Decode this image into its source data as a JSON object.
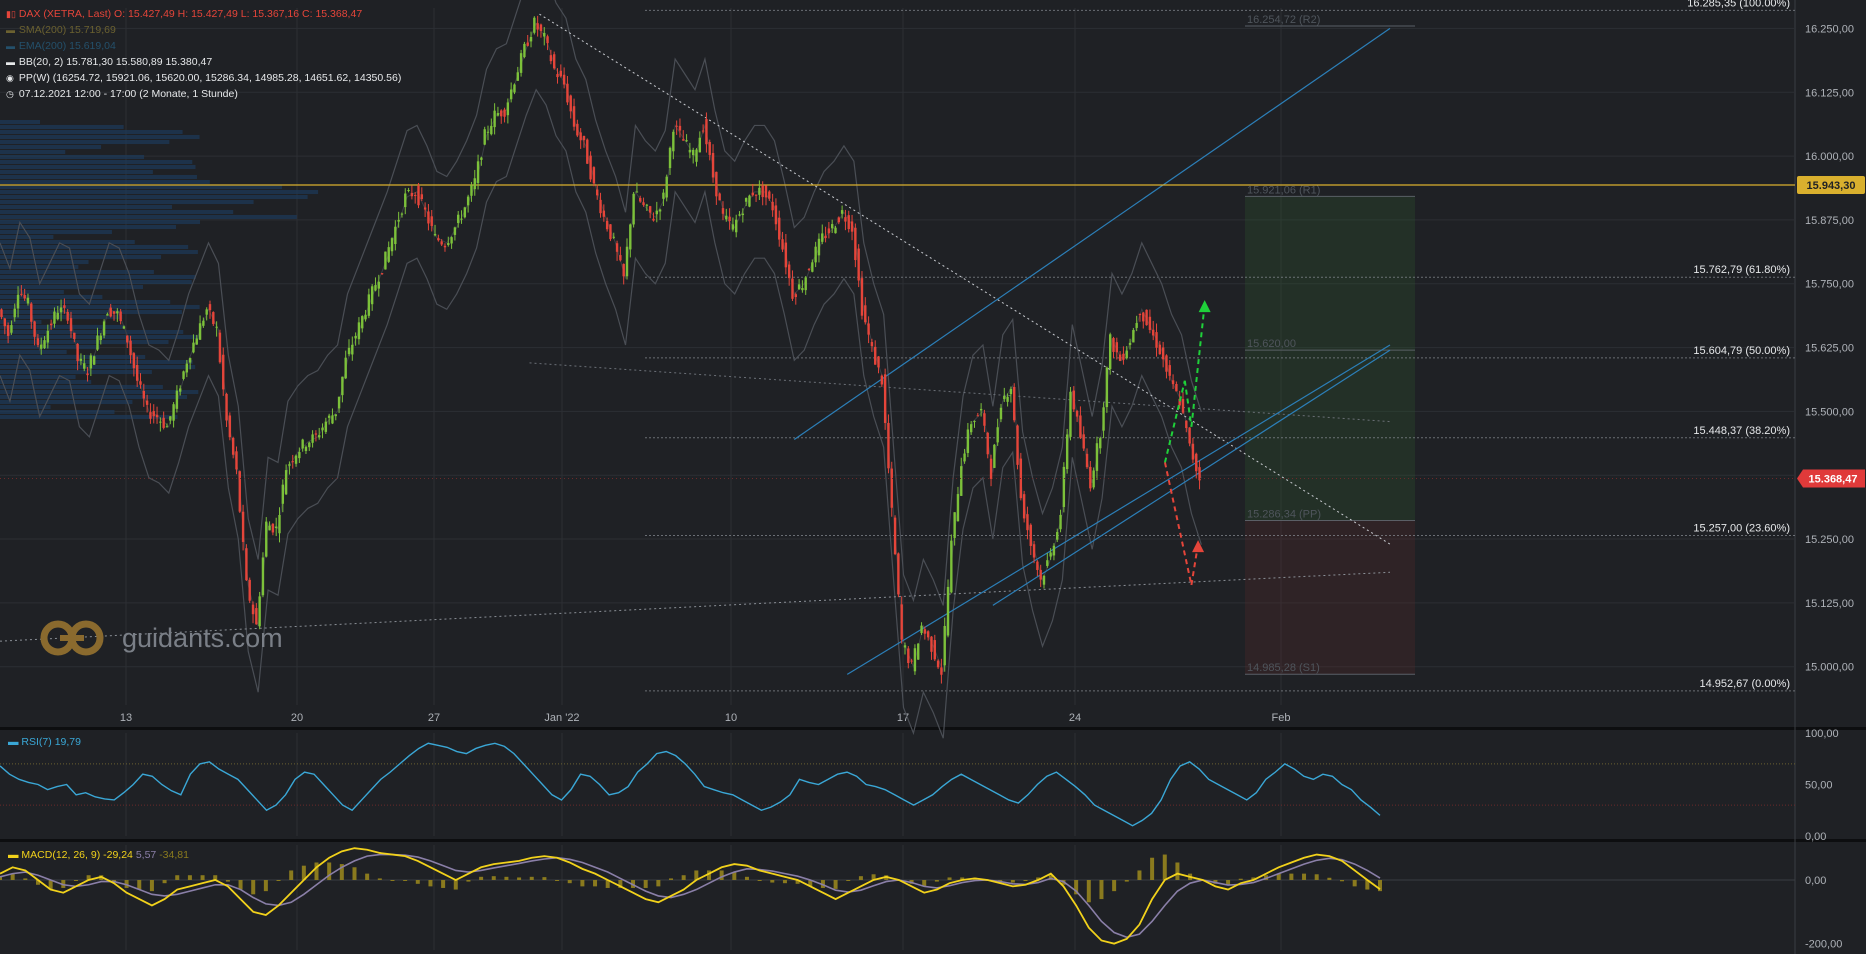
{
  "legend": {
    "instrument": "DAX (XETRA, Last)",
    "ohlc": "O: 15.427,49  H: 15.427,49  L: 15.367,16  C: 15.368,47",
    "sma_label": "SMA(200)",
    "sma_value": "15.719,69",
    "ema_label": "EMA(200)",
    "ema_value": "15.619,04",
    "bb_label": "BB(20, 2)",
    "bb_value": "15.781,30  15.580,89  15.380,47",
    "pp_label": "PP(W)",
    "pp_value": "(16254.72, 15921.06, 15620.00, 15286.34, 14985.28, 14651.62, 14350.56)",
    "period_label": "07.12.2021 12:00 - 17:00",
    "period_value": "(2 Monate, 1 Stunde)"
  },
  "watermark": "guidants.com",
  "colors": {
    "background": "#1f2125",
    "up": "#7cc13a",
    "down": "#e5453a",
    "grid": "#2c2f34",
    "horizontal_line": "#d9b02e",
    "channel": "#2c7fb8",
    "rsi": "#3aa7d6",
    "macd": "#f2d21b",
    "signal": "#8a7fa8",
    "histogram": "#8a7a1e",
    "price_badge": "#e03a3a"
  },
  "chart_data": [
    {
      "type": "candlestick",
      "title": "DAX (XETRA, Last)",
      "x_ticks": [
        "13",
        "20",
        "27",
        "Jan '22",
        "10",
        "17",
        "24",
        "Feb"
      ],
      "y_ticks": [
        "16.250,00",
        "16.125,00",
        "16.000,00",
        "15.875,00",
        "15.750,00",
        "15.625,00",
        "15.500,00",
        "15.375,00",
        "15.250,00",
        "15.125,00",
        "15.000,00"
      ],
      "ylim": [
        14925,
        16290
      ],
      "y_tick_values": [
        16250,
        16125,
        16000,
        15875,
        15750,
        15625,
        15500,
        15375,
        15250,
        15125,
        15000
      ],
      "pivot_labels": [
        "16.254,72 (R2)",
        "15.921,06 (R1)",
        "15.620,00",
        "15.286,34 (PP)",
        "14.985,28 (S1)"
      ],
      "pivot_values": [
        16254.72,
        15921.06,
        15620.0,
        15286.34,
        14985.28
      ],
      "fib_labels": [
        "16.285,35 (100.00%)",
        "15.762,79 (61.80%)",
        "15.604,79 (50.00%)",
        "15.448,37 (38.20%)",
        "15.257,00 (23.60%)",
        "14.952,67 (0.00%)"
      ],
      "fib_values": [
        16285.35,
        15762.79,
        15604.79,
        15448.37,
        15257.0,
        14952.67
      ],
      "horizontal_line": {
        "label": "15.943,30",
        "value": 15943.3
      },
      "last_price": {
        "label": "15.368,47",
        "value": 15368.47
      },
      "close_path": [
        [
          0,
          15700
        ],
        [
          3,
          15650
        ],
        [
          6,
          15740
        ],
        [
          9,
          15710
        ],
        [
          12,
          15620
        ],
        [
          15,
          15660
        ],
        [
          18,
          15700
        ],
        [
          21,
          15690
        ],
        [
          24,
          15600
        ],
        [
          27,
          15580
        ],
        [
          30,
          15640
        ],
        [
          33,
          15700
        ],
        [
          36,
          15690
        ],
        [
          39,
          15640
        ],
        [
          42,
          15560
        ],
        [
          45,
          15500
        ],
        [
          48,
          15490
        ],
        [
          51,
          15470
        ],
        [
          54,
          15530
        ],
        [
          57,
          15600
        ],
        [
          60,
          15650
        ],
        [
          63,
          15700
        ],
        [
          66,
          15660
        ],
        [
          69,
          15480
        ],
        [
          72,
          15380
        ],
        [
          75,
          15160
        ],
        [
          78,
          15080
        ],
        [
          81,
          15280
        ],
        [
          84,
          15270
        ],
        [
          87,
          15390
        ],
        [
          90,
          15420
        ],
        [
          93,
          15440
        ],
        [
          96,
          15450
        ],
        [
          99,
          15480
        ],
        [
          102,
          15500
        ],
        [
          105,
          15600
        ],
        [
          108,
          15650
        ],
        [
          111,
          15700
        ],
        [
          114,
          15750
        ],
        [
          117,
          15800
        ],
        [
          120,
          15860
        ],
        [
          123,
          15920
        ],
        [
          126,
          15930
        ],
        [
          129,
          15890
        ],
        [
          132,
          15840
        ],
        [
          135,
          15830
        ],
        [
          138,
          15860
        ],
        [
          141,
          15900
        ],
        [
          144,
          15950
        ],
        [
          147,
          16040
        ],
        [
          150,
          16080
        ],
        [
          153,
          16090
        ],
        [
          156,
          16150
        ],
        [
          159,
          16210
        ],
        [
          162,
          16260
        ],
        [
          165,
          16230
        ],
        [
          168,
          16170
        ],
        [
          171,
          16140
        ],
        [
          174,
          16060
        ],
        [
          177,
          16020
        ],
        [
          180,
          15940
        ],
        [
          183,
          15880
        ],
        [
          186,
          15830
        ],
        [
          189,
          15760
        ],
        [
          192,
          15930
        ],
        [
          195,
          15900
        ],
        [
          198,
          15880
        ],
        [
          201,
          15920
        ],
        [
          204,
          16060
        ],
        [
          207,
          16030
        ],
        [
          210,
          16000
        ],
        [
          213,
          16060
        ],
        [
          216,
          15960
        ],
        [
          219,
          15880
        ],
        [
          222,
          15860
        ],
        [
          225,
          15900
        ],
        [
          228,
          15930
        ],
        [
          231,
          15930
        ],
        [
          234,
          15900
        ],
        [
          237,
          15820
        ],
        [
          240,
          15730
        ],
        [
          243,
          15750
        ],
        [
          246,
          15800
        ],
        [
          249,
          15840
        ],
        [
          252,
          15860
        ],
        [
          255,
          15890
        ],
        [
          258,
          15860
        ],
        [
          261,
          15700
        ],
        [
          264,
          15620
        ],
        [
          267,
          15560
        ],
        [
          270,
          15300
        ],
        [
          273,
          15050
        ],
        [
          276,
          15000
        ],
        [
          279,
          15080
        ],
        [
          282,
          15040
        ],
        [
          285,
          14990
        ],
        [
          288,
          15240
        ],
        [
          291,
          15400
        ],
        [
          294,
          15480
        ],
        [
          297,
          15500
        ],
        [
          300,
          15380
        ],
        [
          303,
          15520
        ],
        [
          306,
          15550
        ],
        [
          309,
          15330
        ],
        [
          312,
          15240
        ],
        [
          315,
          15170
        ],
        [
          318,
          15220
        ],
        [
          321,
          15300
        ],
        [
          324,
          15540
        ],
        [
          327,
          15450
        ],
        [
          330,
          15360
        ],
        [
          333,
          15460
        ],
        [
          336,
          15640
        ],
        [
          339,
          15600
        ],
        [
          342,
          15640
        ],
        [
          345,
          15700
        ],
        [
          348,
          15660
        ],
        [
          351,
          15620
        ],
        [
          354,
          15560
        ],
        [
          357,
          15520
        ],
        [
          360,
          15430
        ],
        [
          363,
          15369
        ]
      ],
      "trend_line": [
        [
          163,
          16278
        ],
        [
          420,
          15240
        ]
      ],
      "support_line": [
        [
          0,
          15050
        ],
        [
          420,
          15185
        ]
      ],
      "channel_lower": [
        [
          256,
          14985
        ],
        [
          420,
          15630
        ]
      ],
      "channel_middle": [
        [
          300,
          15120
        ],
        [
          420,
          15620
        ]
      ],
      "channel_upper": [
        [
          240,
          15445
        ],
        [
          420,
          16250
        ]
      ],
      "resistance_line": [
        [
          160,
          15595
        ],
        [
          420,
          15480
        ]
      ],
      "scenario_up": [
        [
          352,
          15400
        ],
        [
          358,
          15560
        ],
        [
          360,
          15470
        ],
        [
          364,
          15710
        ]
      ],
      "scenario_down": [
        [
          352,
          15400
        ],
        [
          360,
          15160
        ],
        [
          362,
          15240
        ]
      ]
    },
    {
      "type": "line",
      "title": "RSI(7)",
      "series": [
        {
          "name": "RSI(7)",
          "last": "19,79"
        }
      ],
      "y_ticks": [
        "100,00",
        "50,00",
        "0,00"
      ],
      "ylim": [
        0,
        100
      ],
      "levels": [
        70,
        30
      ],
      "values": [
        68,
        60,
        55,
        52,
        50,
        45,
        48,
        50,
        40,
        42,
        38,
        36,
        35,
        42,
        50,
        60,
        58,
        50,
        44,
        40,
        60,
        70,
        72,
        65,
        60,
        55,
        45,
        35,
        25,
        30,
        40,
        55,
        62,
        60,
        50,
        40,
        30,
        25,
        35,
        45,
        55,
        62,
        70,
        78,
        85,
        90,
        88,
        86,
        82,
        80,
        85,
        88,
        90,
        87,
        80,
        70,
        60,
        50,
        40,
        35,
        45,
        60,
        58,
        50,
        40,
        42,
        48,
        62,
        70,
        80,
        82,
        78,
        70,
        60,
        48,
        45,
        42,
        40,
        35,
        30,
        25,
        28,
        33,
        40,
        55,
        52,
        50,
        55,
        60,
        62,
        58,
        50,
        48,
        45,
        40,
        35,
        30,
        35,
        40,
        48,
        55,
        60,
        55,
        50,
        45,
        40,
        35,
        32,
        40,
        50,
        58,
        62,
        55,
        48,
        40,
        30,
        25,
        20,
        15,
        10,
        15,
        22,
        35,
        55,
        68,
        72,
        65,
        55,
        50,
        45,
        40,
        35,
        42,
        55,
        62,
        70,
        65,
        58,
        55,
        60,
        58,
        50,
        45,
        35,
        28,
        20
      ],
      "last_value": 19.79
    },
    {
      "type": "line",
      "title": "MACD(12, 26, 9)",
      "series": [
        {
          "name": "MACD",
          "last": "-29,24"
        },
        {
          "name": "Signal",
          "last": "5,57"
        },
        {
          "name": "Histogram",
          "last": "-34,81"
        }
      ],
      "y_ticks": [
        "0,00",
        "-200,00"
      ],
      "ylim": [
        -220,
        110
      ],
      "macd": [
        20,
        40,
        30,
        0,
        -30,
        -40,
        -20,
        0,
        10,
        -10,
        -40,
        -60,
        -80,
        -60,
        -30,
        -20,
        -10,
        0,
        -20,
        -60,
        -100,
        -110,
        -80,
        -40,
        0,
        40,
        70,
        90,
        100,
        95,
        85,
        80,
        75,
        60,
        40,
        20,
        0,
        20,
        40,
        50,
        55,
        60,
        70,
        75,
        70,
        55,
        35,
        20,
        0,
        -20,
        -40,
        -60,
        -70,
        -50,
        -30,
        0,
        20,
        40,
        50,
        45,
        30,
        20,
        10,
        0,
        -20,
        -40,
        -60,
        -40,
        -20,
        0,
        10,
        0,
        -20,
        -40,
        -30,
        -10,
        0,
        5,
        0,
        -10,
        -20,
        -15,
        0,
        20,
        -20,
        -80,
        -150,
        -190,
        -200,
        -185,
        -140,
        -60,
        0,
        20,
        10,
        0,
        -20,
        -30,
        -10,
        0,
        20,
        40,
        55,
        70,
        80,
        75,
        60,
        30,
        0,
        -29
      ],
      "signal": [
        10,
        20,
        25,
        15,
        0,
        -15,
        -20,
        -15,
        -5,
        -5,
        -15,
        -30,
        -45,
        -50,
        -45,
        -35,
        -25,
        -15,
        -15,
        -30,
        -55,
        -75,
        -80,
        -70,
        -45,
        -15,
        15,
        40,
        60,
        75,
        80,
        80,
        78,
        72,
        60,
        45,
        30,
        25,
        30,
        38,
        45,
        52,
        60,
        66,
        70,
        65,
        55,
        40,
        25,
        5,
        -15,
        -35,
        -50,
        -55,
        -45,
        -30,
        -10,
        10,
        25,
        35,
        33,
        28,
        20,
        12,
        0,
        -15,
        -32,
        -38,
        -32,
        -18,
        -5,
        0,
        -8,
        -20,
        -25,
        -18,
        -8,
        -2,
        0,
        -5,
        -12,
        -14,
        -8,
        5,
        -5,
        -35,
        -80,
        -130,
        -165,
        -180,
        -170,
        -130,
        -80,
        -35,
        -10,
        0,
        -8,
        -16,
        -14,
        -8,
        5,
        20,
        35,
        50,
        62,
        68,
        64,
        50,
        30,
        6
      ],
      "last_value": -29.24
    }
  ]
}
